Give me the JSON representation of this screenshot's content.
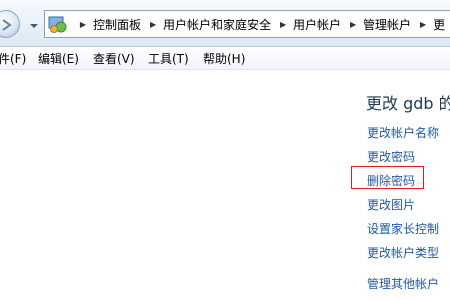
{
  "address_bar": {
    "breadcrumbs": [
      {
        "label": "控制面板"
      },
      {
        "label": "用户帐户和家庭安全"
      },
      {
        "label": "用户帐户"
      },
      {
        "label": "管理帐户"
      },
      {
        "label": "更"
      }
    ]
  },
  "menubar": {
    "items": [
      {
        "label": "件(F)"
      },
      {
        "label": "编辑(E)"
      },
      {
        "label": "查看(V)"
      },
      {
        "label": "工具(T)"
      },
      {
        "label": "帮助(H)"
      }
    ]
  },
  "tasks": {
    "title": "更改 gdb 的",
    "links": [
      {
        "label": "更改帐户名称"
      },
      {
        "label": "更改密码"
      },
      {
        "label": "删除密码"
      },
      {
        "label": "更改图片"
      },
      {
        "label": "设置家长控制"
      },
      {
        "label": "更改帐户类型"
      },
      {
        "label": "管理其他帐户"
      }
    ]
  },
  "colors": {
    "link": "#1e5aa8",
    "highlight": "#e02020"
  }
}
